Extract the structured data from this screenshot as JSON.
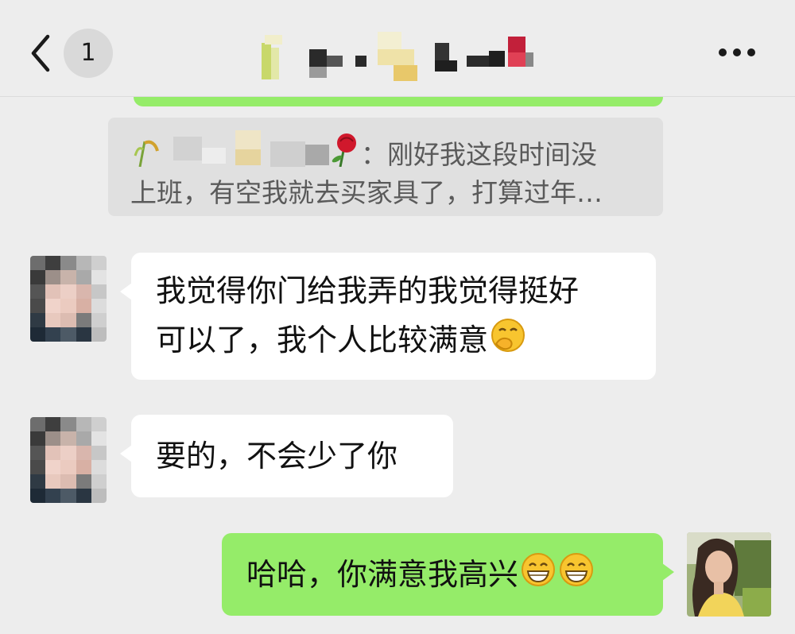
{
  "header": {
    "unread_count": "1",
    "title": "",
    "icons": {
      "back": "chevron-left-icon",
      "more": "more-dots-icon"
    }
  },
  "quote": {
    "sender_name": "",
    "line1": "：刚好我这段时间没",
    "line2": "上班，有空我就去买家具了，打算过年…"
  },
  "messages": [
    {
      "side": "left",
      "lines": [
        "我觉得你门给我弄的我觉得挺好",
        "可以了，我个人比较满意"
      ],
      "emoji": [
        "hand-over-mouth-emoji"
      ]
    },
    {
      "side": "left",
      "lines": [
        "要的，不会少了你"
      ],
      "emoji": []
    },
    {
      "side": "right",
      "lines": [
        "哈哈，你满意我高兴"
      ],
      "emoji": [
        "grinning-emoji",
        "grinning-emoji"
      ]
    }
  ],
  "colors": {
    "background": "#ededed",
    "self_bubble": "#95ec69",
    "other_bubble": "#ffffff",
    "quote_background": "#e0e0e0",
    "quote_text": "#5a5a5a"
  }
}
